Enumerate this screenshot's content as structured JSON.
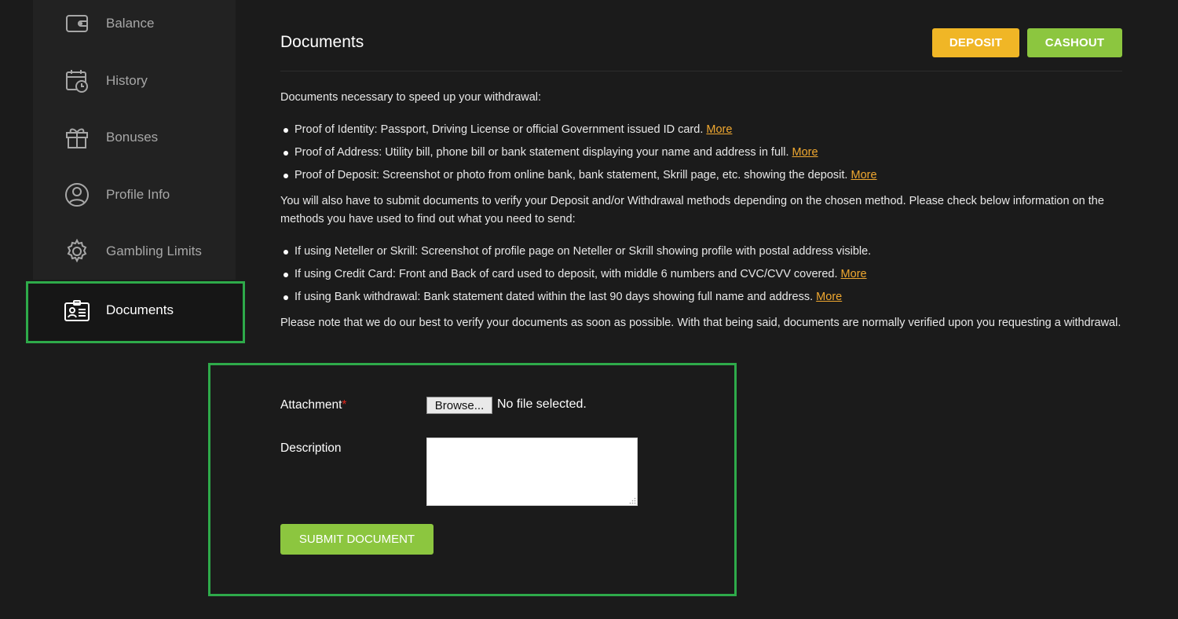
{
  "sidebar": {
    "items": [
      {
        "label": "Balance",
        "icon": "wallet-icon"
      },
      {
        "label": "History",
        "icon": "calendar-clock-icon"
      },
      {
        "label": "Bonuses",
        "icon": "gift-icon"
      },
      {
        "label": "Profile Info",
        "icon": "user-circle-icon"
      },
      {
        "label": "Gambling Limits",
        "icon": "gear-icon"
      },
      {
        "label": "Documents",
        "icon": "id-card-icon",
        "active": true
      }
    ]
  },
  "header": {
    "title": "Documents",
    "deposit_label": "DEPOSIT",
    "cashout_label": "CASHOUT"
  },
  "content": {
    "intro": "Documents necessary to speed up your withdrawal:",
    "required_docs": [
      {
        "text": "Proof of Identity: Passport, Driving License or official Government issued ID card.",
        "link": "More"
      },
      {
        "text": "Proof of Address: Utility bill, phone bill or bank statement displaying your name and address in full.",
        "link": "More"
      },
      {
        "text": "Proof of Deposit: Screenshot or photo from online bank, bank statement, Skrill page, etc. showing the deposit.",
        "link": "More"
      }
    ],
    "methods_intro": "You will also have to submit documents to verify your Deposit and/or Withdrawal methods depending on the chosen method. Please check below information on the methods you have used to find out what you need to send:",
    "method_docs": [
      {
        "text": "If using Neteller or Skrill: Screenshot of profile page on Neteller or Skrill showing profile with postal address visible.",
        "link": ""
      },
      {
        "text": "If using Credit Card: Front and Back of card used to deposit, with middle 6 numbers and CVC/CVV covered.",
        "link": "More"
      },
      {
        "text": "If using Bank withdrawal: Bank statement dated within the last 90 days showing full name and address.",
        "link": "More"
      }
    ],
    "note": "Please note that we do our best to verify your documents as soon as possible. With that being said, documents are normally verified upon you requesting a withdrawal."
  },
  "form": {
    "attachment_label": "Attachment",
    "required_mark": "*",
    "browse_label": "Browse...",
    "no_file_text": "No file selected.",
    "description_label": "Description",
    "description_value": "",
    "submit_label": "SUBMIT DOCUMENT"
  },
  "colors": {
    "background": "#1b1b1b",
    "sidebar": "#222222",
    "deposit": "#f0b626",
    "cashout": "#8cc63f",
    "link": "#f0a830",
    "highlight": "#2eaa4a",
    "required": "#e0241b"
  }
}
